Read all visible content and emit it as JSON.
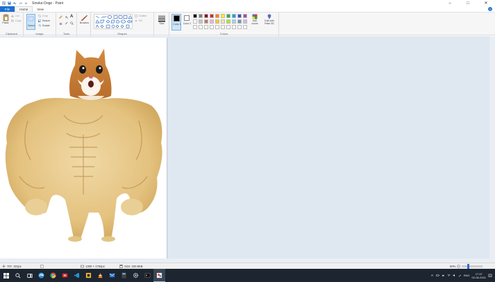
{
  "window": {
    "title": "Smoke-Doge - Paint",
    "minimize_glyph": "–",
    "maximize_glyph": "□",
    "close_glyph": "✕"
  },
  "menu": {
    "tabs": [
      "File",
      "Home",
      "View"
    ],
    "help_glyph": "?"
  },
  "ribbon": {
    "clipboard": {
      "label": "Clipboard",
      "paste": "Paste",
      "cut": "Cut",
      "copy": "Copy"
    },
    "image": {
      "label": "Image",
      "select": "Select",
      "crop": "Crop",
      "resize": "Resize",
      "rotate": "Rotate"
    },
    "tools": {
      "label": "Tools",
      "text_glyph": "A"
    },
    "brushes": "Brushes",
    "shapes": {
      "label": "Shapes",
      "outline": "Outline",
      "fill": "Fill"
    },
    "size": "Size",
    "colors": {
      "label": "Colors",
      "color1": "Color 1",
      "color2": "Color 2",
      "edit_colors": "Edit colors",
      "edit_paint3d": "Edit with Paint 3D",
      "color1_value": "#000000",
      "color2_value": "#ffffff",
      "palette_row1": [
        "#000000",
        "#7f7f7f",
        "#880015",
        "#ed1c24",
        "#ff7f27",
        "#fff200",
        "#22b14c",
        "#00a2e8",
        "#3f48cc",
        "#a349a4"
      ],
      "palette_row2": [
        "#ffffff",
        "#c3c3c3",
        "#b97a57",
        "#ffaec9",
        "#ffc90e",
        "#efe4b0",
        "#b5e61d",
        "#99d9ea",
        "#7092be",
        "#c8bfe7"
      ],
      "palette_row3": [
        "#ffffff",
        "#ffffff",
        "#ffffff",
        "#ffffff",
        "#ffffff",
        "#ffffff",
        "#ffffff",
        "#ffffff",
        "#ffffff",
        "#ffffff"
      ]
    }
  },
  "status": {
    "cursor_pos": "707, 331px",
    "selection_size": "",
    "image_size": "1300 × 1762px",
    "file_size": "Size: 220.8KB",
    "zoom": "50%"
  },
  "taskbar": {
    "language": "ENG",
    "time": "17:37",
    "date": "02-06-2021"
  }
}
